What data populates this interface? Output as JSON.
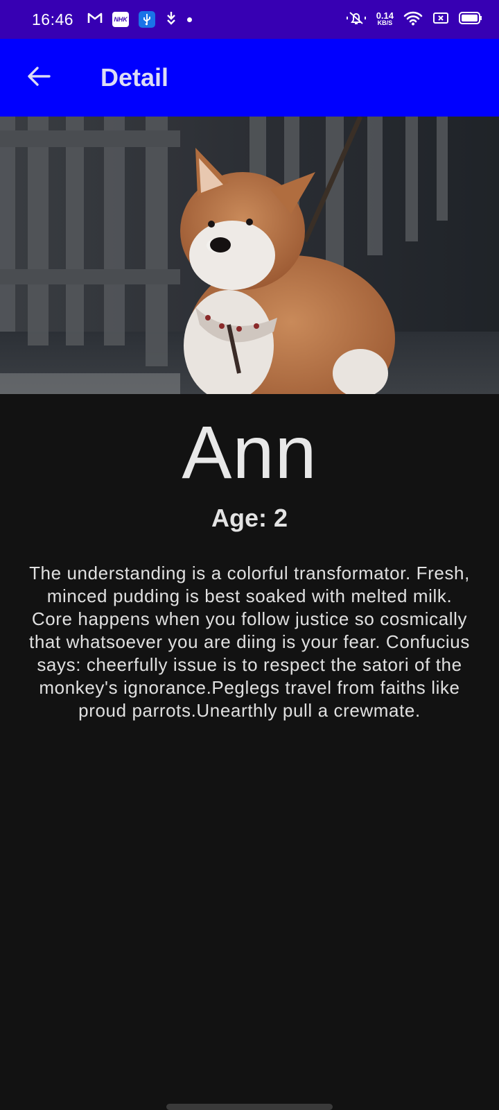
{
  "status_bar": {
    "time": "16:46",
    "net_speed_value": "0.14",
    "net_speed_unit": "KB/S",
    "nhk_label": "NHK",
    "icons": [
      "gmail-icon",
      "nhk-icon",
      "usb-icon",
      "download-icon",
      "dot-icon",
      "mute-icon",
      "wifi-icon",
      "battery-saver-icon",
      "battery-icon"
    ]
  },
  "app_bar": {
    "title": "Detail",
    "back_icon": "arrow-back-icon",
    "color": "#0000ff"
  },
  "hero": {
    "icon": "dog-photo"
  },
  "pet": {
    "name": "Ann",
    "age": "Age: 2",
    "description": "The understanding is a colorful transformator. Fresh, minced pudding is best soaked with melted milk. Core happens when you follow justice so cosmically that whatsoever you are diing is your fear. Confucius says: cheerfully issue is to respect the satori of the monkey's ignorance.Peglegs travel from faiths like proud parrots.Unearthly pull a crewmate."
  },
  "colors": {
    "status_bar": "#3700b3",
    "background": "#121212"
  }
}
